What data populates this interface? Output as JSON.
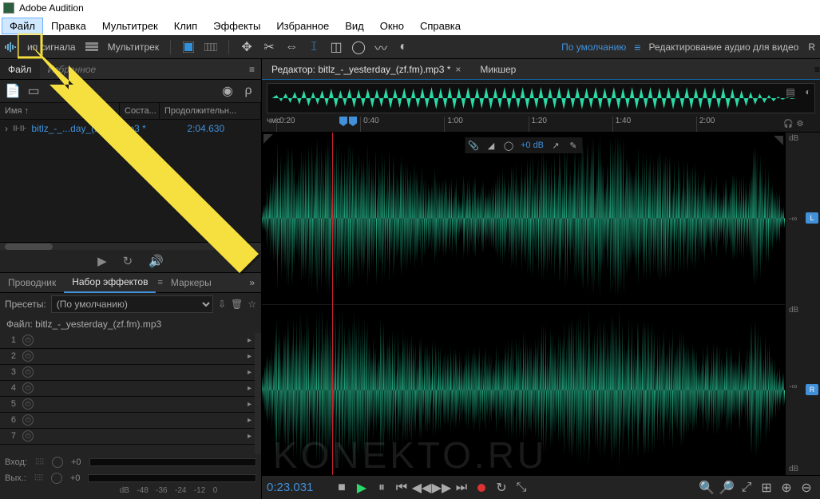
{
  "app": {
    "title": "Adobe Audition"
  },
  "menu": [
    "Файл",
    "Правка",
    "Мультитрек",
    "Клип",
    "Эффекты",
    "Избранное",
    "Вид",
    "Окно",
    "Справка"
  ],
  "toolbar": {
    "mode_waveform": "ип сигнала",
    "mode_multitrack": "Мультитрек",
    "ws_default": "По умолчанию",
    "ws_audio_for_video": "Редактирование аудио для видео",
    "ws_more": "R"
  },
  "files": {
    "tab_files": "Файл",
    "tab_favorites": "Избранное",
    "col_name": "Имя ↑",
    "col_state": "Соста...",
    "col_duration": "Продолжительн...",
    "row_name": "bitlz_-_...day_(zf.fm).mp3 *",
    "row_duration": "2:04.630"
  },
  "effects": {
    "tab_explorer": "Проводник",
    "tab_rack": "Набор эффектов",
    "tab_markers": "Маркеры",
    "presets_label": "Пресеты:",
    "presets_value": "(По умолчанию)",
    "file_label": "Файл: bitlz_-_yesterday_(zf.fm).mp3",
    "slots": [
      "1",
      "2",
      "3",
      "4",
      "5",
      "6",
      "7"
    ],
    "input": "Вход:",
    "output": "Вых.:",
    "gain": "+0",
    "db_ticks": [
      "dB",
      "-48",
      "-36",
      "-24",
      "-12",
      "0"
    ]
  },
  "editor": {
    "tab_editor": "Редактор: bitlz_-_yesterday_(zf.fm).mp3 *",
    "tab_mixer": "Микшер",
    "hms": "чмс",
    "ticks": [
      "0:20",
      "0:40",
      "1:00",
      "1:20",
      "1:40",
      "2:00"
    ],
    "hud_db": "+0 dB",
    "db_labels_top": "dB",
    "db_inf": "-∞",
    "badge_l": "L",
    "badge_r": "R",
    "playhead_time": "0:23.031"
  },
  "watermark": "KONEKTO.RU"
}
